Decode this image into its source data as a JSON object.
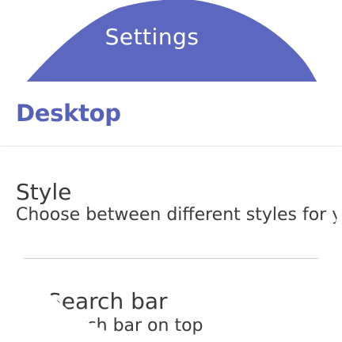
{
  "header": {
    "title": "Settings",
    "color": "#5c68bf"
  },
  "category": {
    "label": "Desktop",
    "color": "#5661b8"
  },
  "preferences": [
    {
      "title": "Style",
      "summary": "Choose between different styles for y"
    },
    {
      "title": "Search bar",
      "summary": "Search bar on top"
    }
  ]
}
